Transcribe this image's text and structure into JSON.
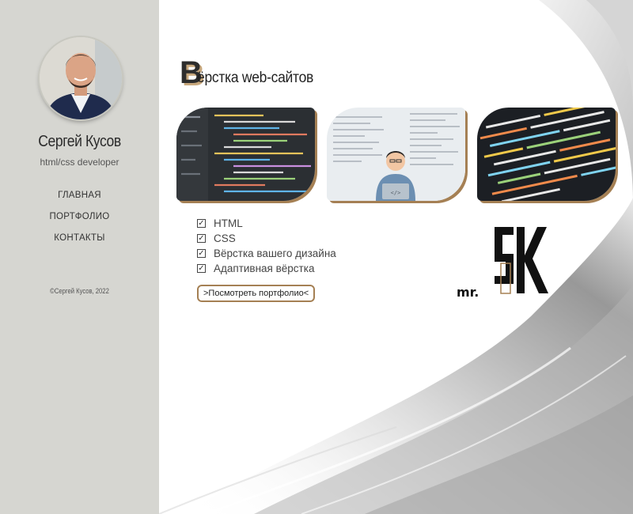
{
  "sidebar": {
    "name": "Сергей Кусов",
    "role": "html/css developer",
    "nav": [
      {
        "label": "ГЛАВНАЯ"
      },
      {
        "label": "ПОРТФОЛИО"
      },
      {
        "label": "КОНТАКТЫ"
      }
    ],
    "copyright": "©Сергей Кусов, 2022"
  },
  "main": {
    "title_first_letter": "В",
    "title_rest": "ёрстка web-сайтов",
    "skills": [
      {
        "label": "HTML"
      },
      {
        "label": "CSS"
      },
      {
        "label": "Вёрстка вашего дизайна"
      },
      {
        "label": "Адаптивная вёрстка"
      }
    ],
    "portfolio_button": ">Посмотреть портфолио<",
    "logo_text": "mr."
  },
  "colors": {
    "sidebar_bg": "#d6d6d1",
    "accent": "#a58054"
  },
  "icons": [
    "checkbox-checked-icon"
  ]
}
